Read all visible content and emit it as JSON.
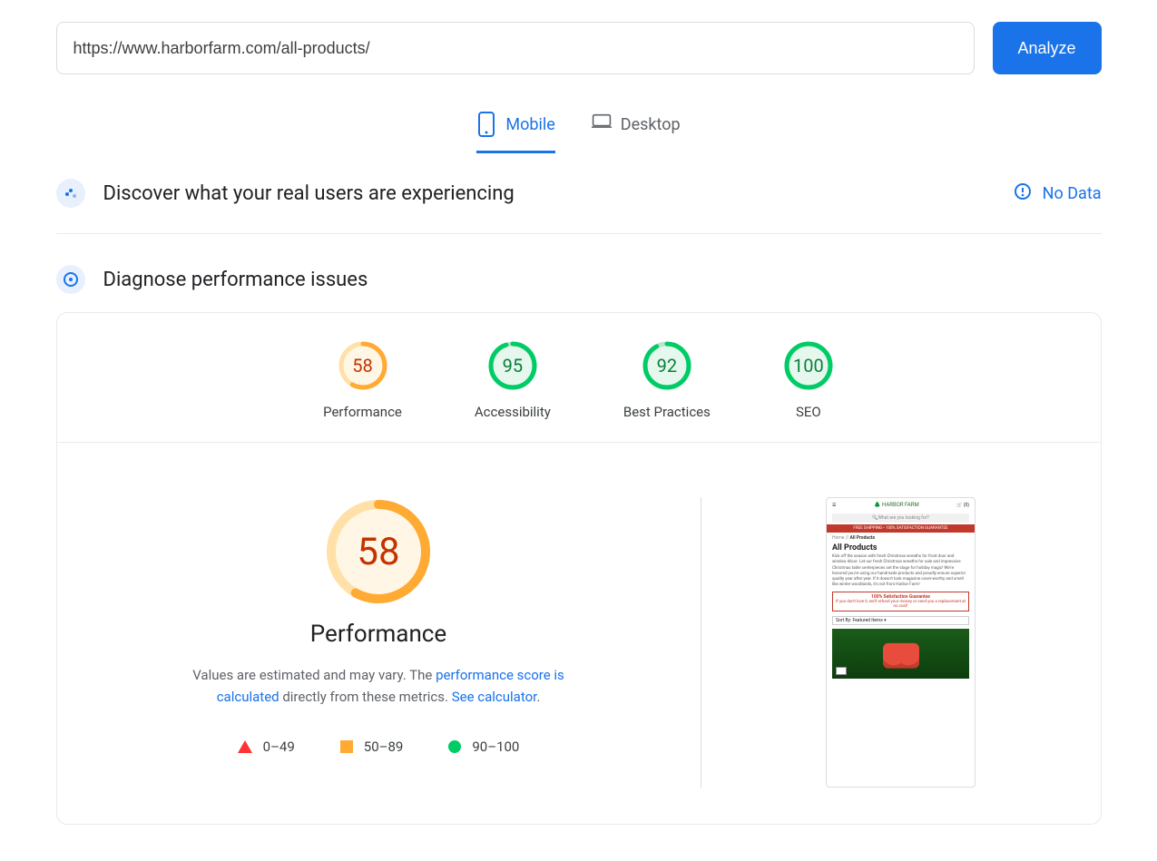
{
  "url_input": "https://www.harborfarm.com/all-products/",
  "analyze_label": "Analyze",
  "tabs": {
    "mobile": "Mobile",
    "desktop": "Desktop"
  },
  "discover": {
    "title": "Discover what your real users are experiencing",
    "no_data": "No Data"
  },
  "diagnose": {
    "title": "Diagnose performance issues"
  },
  "gauges": {
    "performance": {
      "score": "58",
      "label": "Performance",
      "color": "#fa3",
      "bg": "#fff6e6",
      "pct": 58
    },
    "accessibility": {
      "score": "95",
      "label": "Accessibility",
      "color": "#0c6",
      "bg": "#e6f7ed",
      "pct": 95
    },
    "best_practices": {
      "score": "92",
      "label": "Best Practices",
      "color": "#0c6",
      "bg": "#e6f7ed",
      "pct": 92
    },
    "seo": {
      "score": "100",
      "label": "SEO",
      "color": "#0c6",
      "bg": "#e6f7ed",
      "pct": 100
    }
  },
  "perf_detail": {
    "score": "58",
    "title": "Performance",
    "desc_pre": "Values are estimated and may vary. The ",
    "link1": "performance score is calculated",
    "desc_mid": " directly from these metrics. ",
    "link2": "See calculator"
  },
  "legend": {
    "r0": "0–49",
    "r1": "50–89",
    "r2": "90–100"
  },
  "screenshot": {
    "logo": "🌲 HARBOR FARM",
    "cart": "🛒 (0)",
    "search": "What are you looking for?",
    "banner": "FREE SHIPPING • 100% SATISFACTION GUARANTEE",
    "bc_home": "Home",
    "bc_sep": " // ",
    "bc_cur": "All Products",
    "h": "All Products",
    "p": "Kick off the season with fresh Christmas wreaths for front door and window décor. Let our fresh Christmas wreaths for sale and impressive Christmas table centerpieces set the stage for holiday magic! We're honored you're using our handmade products and proudly ensure superior quality year after year. If it doesn't look magazine cover-worthy and smell like winter woodlands, it's not from Harbor Farm!",
    "g1": "100% Satisfaction Guarantee",
    "g2": "If you don't love it, we'll refund your money or send you a replacement at no cost!",
    "sort": "Sort By: Featured Items ▾"
  }
}
